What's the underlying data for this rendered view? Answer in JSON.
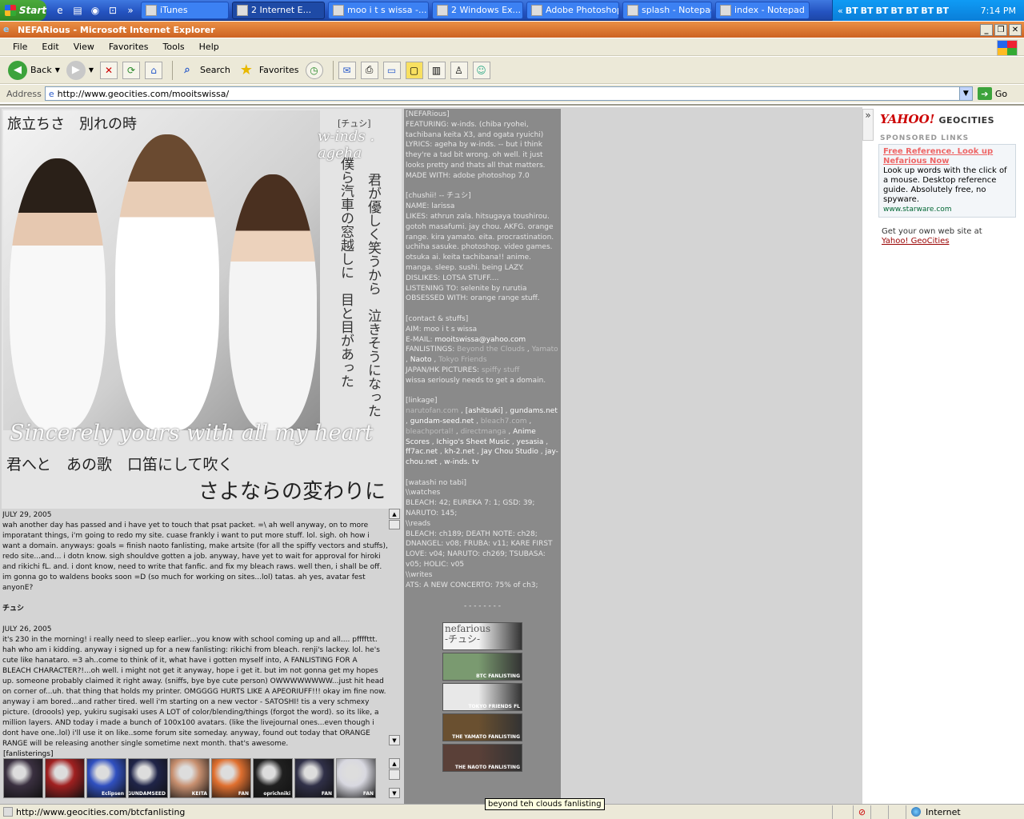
{
  "taskbar": {
    "start": "Start",
    "tasks": [
      {
        "label": "iTunes",
        "active": false
      },
      {
        "label": "2 Internet E...",
        "active": true
      },
      {
        "label": "moo i t s wissa -...",
        "active": false
      },
      {
        "label": "2 Windows Ex...",
        "active": false
      },
      {
        "label": "Adobe Photoshop",
        "active": false
      },
      {
        "label": "splash - Notepad",
        "active": false
      },
      {
        "label": "index - Notepad",
        "active": false
      }
    ],
    "tray_icons": [
      "BT",
      "BT",
      "BT",
      "BT",
      "BT",
      "BT",
      "BT"
    ],
    "clock": "7:14 PM"
  },
  "window": {
    "title": "NEFARious - Microsoft Internet Explorer"
  },
  "menu": [
    "File",
    "Edit",
    "View",
    "Favorites",
    "Tools",
    "Help"
  ],
  "toolbar": {
    "back": "Back",
    "search": "Search",
    "favorites": "Favorites"
  },
  "address": {
    "label": "Address",
    "url": "http://www.geocities.com/mooitswissa/",
    "go": "Go"
  },
  "banner": {
    "jp_top_left": "旅立ちさ　別れの時",
    "artist_tag": "[チュシ]",
    "artist": "w-inds . ageha",
    "jp_vertical_1": "君が優しく笑うから　泣きそうになった",
    "jp_vertical_2": "僕ら汽車の窓越しに　目と目があった",
    "script_line": "Sincerely yours with all my heart",
    "jp_bottom_1": "君へと　あの歌　口笛にして吹く",
    "jp_bottom_2": "さよならの変わりに"
  },
  "journal": {
    "entries": [
      {
        "date": "JULY 29, 2005",
        "body": "wah another day has passed and i have yet to touch that psat packet. =\\ ah well anyway, on to more imporatant things, i'm going to redo my site. cuase frankly i want to put more stuff. lol. sigh. oh how i want a domain. anyways: goals = finish naoto fanlisting, make artsite (for all the spiffy vectors and stuffs), redo site...and... i dotn know. sigh shouldve gotten a job. anyway, have yet to wait for approval for hiroki and rikichi fL. and. i dont know, need to write that fanfic. and fix my bleach raws. well then, i shall be off. im gonna go to waldens books soon =D (so much for working on sites...lol) tatas. ah yes, avatar fest anyonE?",
        "sign": "チュシ"
      },
      {
        "date": "JULY 26, 2005",
        "body": "it's 230 in the morning! i really need to sleep earlier...you know with school coming up and all.... pffffttt. hah who am i kidding. anyway i signed up for a new fanlisting: rikichi from bleach. renji's lackey. lol. he's cute like hanataro. =3 ah..come to think of it, what have i gotten myself into, A FANLISTING FOR A BLEACH CHARACTER?!...oh well. i might not get it anyway, hope i get it. but im not gonna get my hopes up. someone probably claimed it right away. (sniffs, bye bye cute person) OWWWWWWWW...just hit head on corner of...uh. that thing that holds my printer. OMGGGG HURTS LIKE A APEORIUFF!!! okay im fine now. anyway i am bored...and rather tired. well i'm starting on a new vector - SATOSHI! tis a very schmexy picture. (droools) yep, yukiru sugisaki uses A LOT of color/blending/things (forgot the word). so its like, a million layers. AND today i made a bunch of 100x100 avatars. (like the livejournal ones...even though i dont have one..lol) i'll use it on like..some forum site someday. anyway, found out today that ORANGE RANGE will be releasing another single sometime next month. that's awesome."
      }
    ]
  },
  "fanlisterings": {
    "label": "[fanlisterings]",
    "icons": [
      {
        "tag": "",
        "color": "#3a3040"
      },
      {
        "tag": "",
        "color": "#a02020"
      },
      {
        "tag": "Eclipsen",
        "color": "#3050c0"
      },
      {
        "tag": "GUNDAMSEED",
        "color": "#1f2448"
      },
      {
        "tag": "KEITA",
        "color": "#c89070"
      },
      {
        "tag": "FAN",
        "color": "#e07030"
      },
      {
        "tag": "oprichniki",
        "color": "#202020"
      },
      {
        "tag": "FAN",
        "color": "#303048"
      },
      {
        "tag": "FAN",
        "color": "#d8d8e0"
      }
    ]
  },
  "sidebar": {
    "sections": [
      {
        "heading": "[NEFARious]",
        "lines": [
          "FEATURING: w-inds. (chiba ryohei, tachibana keita X3, and ogata ryuichi)",
          "LYRICS: ageha by w-inds. -- but i think they're a tad bit wrong. oh well. it just looks pretty and thats all that matters.",
          "MADE WITH: adobe photoshop 7.0"
        ]
      },
      {
        "heading": "[chushii! -- チュシ]",
        "lines": [
          "NAME: larissa",
          "LIKES: athrun zala. hitsugaya toushirou. gotoh masafumi. jay chou. AKFG. orange range. kira yamato. eita. procrastination. uchiha sasuke. photoshop. video games. otsuka ai. keita tachibana!! anime. manga. sleep. sushi. being LAZY.",
          "DISLIKES: LOTSA STUFF....",
          "LISTENING TO: selenite by rurutia",
          "OBSESSED WITH: orange range stuff."
        ]
      }
    ],
    "contact": {
      "heading": "[contact & stuffs]",
      "aim": "AIM: moo i t s wissa",
      "email_label": "E-MAIL:",
      "email": "mooitswissa@yahoo.com",
      "fanlistings_label": "FANLISTINGS:",
      "fanlistings": [
        "Beyond the Clouds",
        "Yamato",
        "Naoto",
        "Tokyo Friends"
      ],
      "pictures_label": "JAPAN/HK PICTURES:",
      "pictures": "spiffy stuff",
      "domain_note": "wissa seriously needs to get a domain."
    },
    "linkage": {
      "heading": "[linkage]",
      "links": [
        {
          "text": "narutofan.com",
          "bright": false
        },
        {
          "text": "[ashitsuki]",
          "bright": true
        },
        {
          "text": "gundams.net",
          "bright": true
        },
        {
          "text": "gundam-seed.net",
          "bright": true
        },
        {
          "text": "bleach7.com",
          "bright": false
        },
        {
          "text": "bleachportal!",
          "bright": false
        },
        {
          "text": "directmanga",
          "bright": false
        },
        {
          "text": "Anime Scores",
          "bright": true
        },
        {
          "text": "Ichigo's Sheet Music",
          "bright": true
        },
        {
          "text": "yesasia",
          "bright": true
        },
        {
          "text": "ff7ac.net",
          "bright": true
        },
        {
          "text": "kh-2.net",
          "bright": true
        },
        {
          "text": "Jay Chou Studio",
          "bright": true
        },
        {
          "text": "jay-chou.net",
          "bright": true
        },
        {
          "text": "w-inds. tv",
          "bright": true
        }
      ]
    },
    "watashi": {
      "heading": "[watashi no tabi]",
      "lines": [
        "\\\\watches",
        "BLEACH: 42; EUREKA 7: 1; GSD: 39; NARUTO: 145;",
        "\\\\reads",
        "BLEACH: ch189; DEATH NOTE: ch28; DNANGEL: v08; FRUBA: v11; KARE FIRST LOVE: v04; NARUTO: ch269; TSUBASA: v05; HOLIC: v05",
        "\\\\writes",
        "ATS: A NEW CONCERTO: 75% of ch3;"
      ]
    },
    "dashes": "- - - - - - - -",
    "buttons": [
      {
        "text": "nefarious -チュシ-",
        "bg": "#f2f2f2"
      },
      {
        "text": "BTC FANLISTING",
        "bg": "#7a9a70"
      },
      {
        "text": "TOKYO FRIENDS FL",
        "bg": "#e8e8e8"
      },
      {
        "text": "THE YAMATO FANLISTING",
        "bg": "#6a5030"
      },
      {
        "text": "THE NAOTO FANLISTING",
        "bg": "#5a4038"
      }
    ]
  },
  "tooltip": "beyond teh clouds fanlisting",
  "yahoo": {
    "logo": "YAHOO!",
    "geo": "GEOCITIES",
    "sponsored": "SPONSORED LINKS",
    "ad_title": "Free Reference. Look up Nefarious Now",
    "ad_body": "Look up words with the click of a mouse. Desktop reference guide. Absolutely free, no spyware.",
    "ad_url": "www.starware.com",
    "get_own": "Get your own web site at",
    "get_own_link": "Yahoo! GeoCities"
  },
  "status": {
    "url": "http://www.geocities.com/btcfanlisting",
    "zone": "Internet"
  }
}
